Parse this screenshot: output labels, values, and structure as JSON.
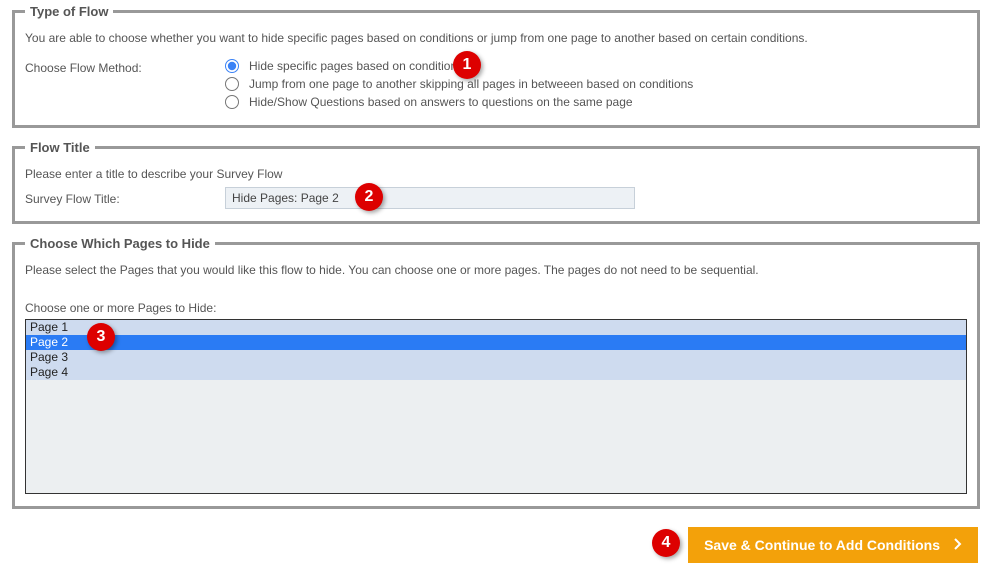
{
  "type_of_flow": {
    "legend": "Type of Flow",
    "desc": "You are able to choose whether you want to hide specific pages based on conditions or jump from one page to another based on certain conditions.",
    "label": "Choose Flow Method:",
    "options": {
      "hide": "Hide specific pages based on conditions",
      "jump": "Jump from one page to another skipping all pages in betweeen based on conditions",
      "hideshow": "Hide/Show Questions based on answers to questions on the same page"
    }
  },
  "flow_title": {
    "legend": "Flow Title",
    "desc": "Please enter a title to describe your Survey Flow",
    "label": "Survey Flow Title:",
    "value": "Hide Pages: Page 2"
  },
  "choose_pages": {
    "legend": "Choose Which Pages to Hide",
    "desc": "Please select the Pages that you would like this flow to hide. You can choose one or more pages. The pages do not need to be sequential.",
    "sublabel": "Choose one or more Pages to Hide:",
    "pages": [
      "Page 1",
      "Page 2",
      "Page 3",
      "Page 4"
    ],
    "selected_index": 1
  },
  "footer": {
    "save_label": "Save & Continue to Add Conditions"
  },
  "badges": {
    "b1": "1",
    "b2": "2",
    "b3": "3",
    "b4": "4"
  }
}
